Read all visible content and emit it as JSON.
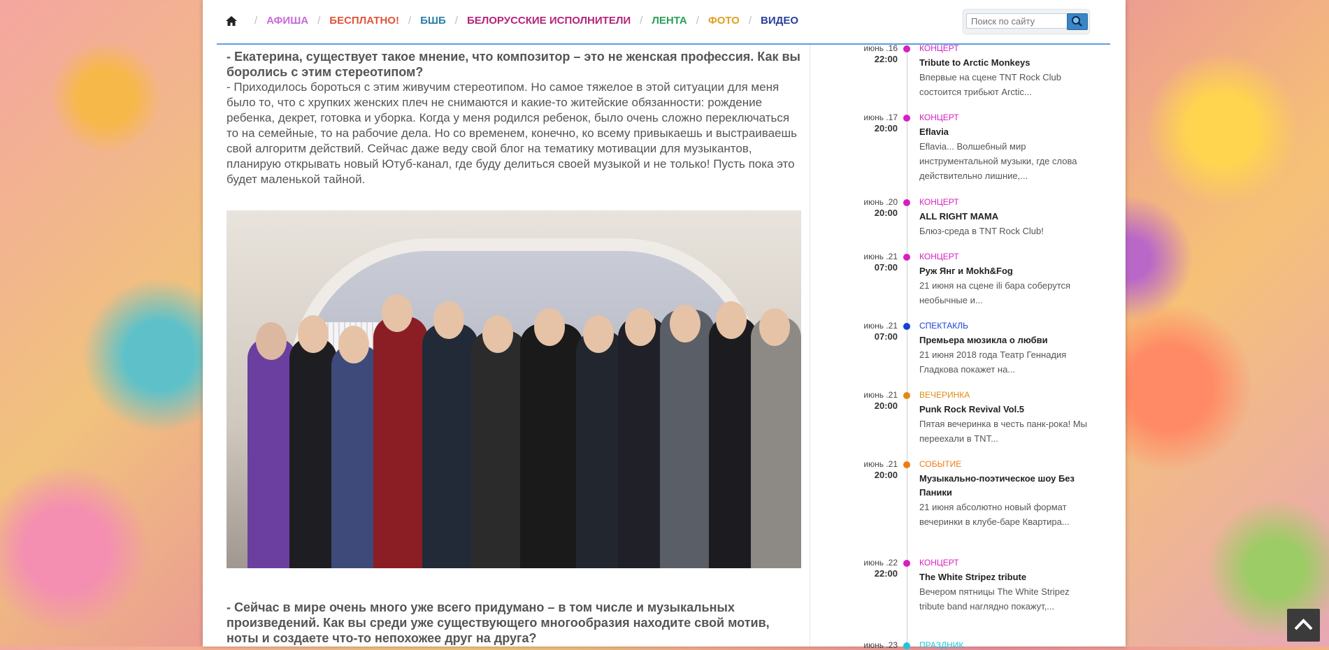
{
  "nav": {
    "home_icon": "home-icon",
    "items": [
      {
        "label": "АФИША",
        "color": "#c86ad9"
      },
      {
        "label": "БЕСПЛАТНО!",
        "color": "#e0553a"
      },
      {
        "label": "БШБ",
        "color": "#2a7fa8"
      },
      {
        "label": "БЕЛОРУССКИЕ ИСПОЛНИТЕЛИ",
        "color": "#b5247a"
      },
      {
        "label": "ЛЕНТА",
        "color": "#2aa05a"
      },
      {
        "label": "ФОТО",
        "color": "#e0a020"
      },
      {
        "label": "ВИДЕО",
        "color": "#2a3f9a"
      }
    ],
    "search_placeholder": "Поиск по сайту",
    "search_icon": "search-icon"
  },
  "article": {
    "question1": "- Екатерина, существует такое мнение, что композитор – это не женская профессия. Как вы боролись с этим стереотипом?",
    "answer1": "- Приходилось бороться с этим живучим стереотипом. Но самое тяжелое в этой ситуации для меня было то, что с хрупких женских плеч не снимаются и какие-то житейские обязанности: рождение ребенка, декрет, готовка и уборка. Когда у меня родился ребенок, было очень сложно переключаться то на семейные, то на  рабочие дела. Но со временем, конечно, ко всему привыкаешь и выстраиваешь свой алгоритм действий. Сейчас даже веду свой блог на тематику мотивации для музыкантов, планирую открывать новый Ютуб-канал, где буду делиться своей музыкой и не только! Пусть пока это будет маленькой тайной.",
    "question2": "- Сейчас в мире очень много уже всего придумано – в том числе и музыкальных произведений. Как вы среди уже существующего многообразия находите свой мотив, ноты и создаете что-то непохожее друг на друга?"
  },
  "events": [
    {
      "date": "июнь .16",
      "time": "22:00",
      "category": "КОНЦЕРТ",
      "cat_color": "#d81ec2",
      "title": "Tribute to Arctic Monkeys",
      "desc": "Впервые на сцене TNT Rock Club состоится трибьют Arctic..."
    },
    {
      "date": "июнь .17",
      "time": "20:00",
      "category": "КОНЦЕРТ",
      "cat_color": "#d81ec2",
      "title": "Eflavia",
      "desc": "Eflavia... Волшебный мир инструментальной музыки, где слова действительно лишние,..."
    },
    {
      "date": "июнь .20",
      "time": "20:00",
      "category": "КОНЦЕРТ",
      "cat_color": "#d81ec2",
      "title": "ALL RIGHT MAMA",
      "desc": "Блюз-среда в TNT Rock Club!"
    },
    {
      "date": "июнь .21",
      "time": "07:00",
      "category": "КОНЦЕРТ",
      "cat_color": "#d81ec2",
      "title": "Руж Янг и Mokh&Fog",
      "desc": "21 июня на сцене ili бара соберутся необычные и..."
    },
    {
      "date": "июнь .21",
      "time": "07:00",
      "category": "СПЕКТАКЛЬ",
      "cat_color": "#1a3fd8",
      "title": "Премьера мюзикла о любви",
      "desc": "21 июня 2018 года Театр Геннадия Гладкова покажет на..."
    },
    {
      "date": "июнь .21",
      "time": "20:00",
      "category": "ВЕЧЕРИНКА",
      "cat_color": "#e08a14",
      "title": "Punk Rock Revival Vol.5",
      "desc": "Пятая вечеринка в честь панк-рока! Мы переехали в TNT..."
    },
    {
      "date": "июнь .21",
      "time": "20:00",
      "category": "СОБЫТИЕ",
      "cat_color": "#f07a14",
      "title": "Музыкально-поэтическое шоу Без Паники",
      "desc": "21 июня абсолютно новый формат вечеринки в клубе-баре Квартира..."
    },
    {
      "date": "июнь .22",
      "time": "22:00",
      "category": "КОНЦЕРТ",
      "cat_color": "#d81ec2",
      "title": "The White Stripez tribute",
      "desc": "Вечером пятницы The White Stripez tribute band наглядно покажут,..."
    },
    {
      "date": "июнь .23",
      "time": "",
      "category": "ПРАЗДНИК",
      "cat_color": "#1ec6d8",
      "title": "",
      "desc": ""
    }
  ],
  "scroll_top_icon": "chevron-up-icon"
}
